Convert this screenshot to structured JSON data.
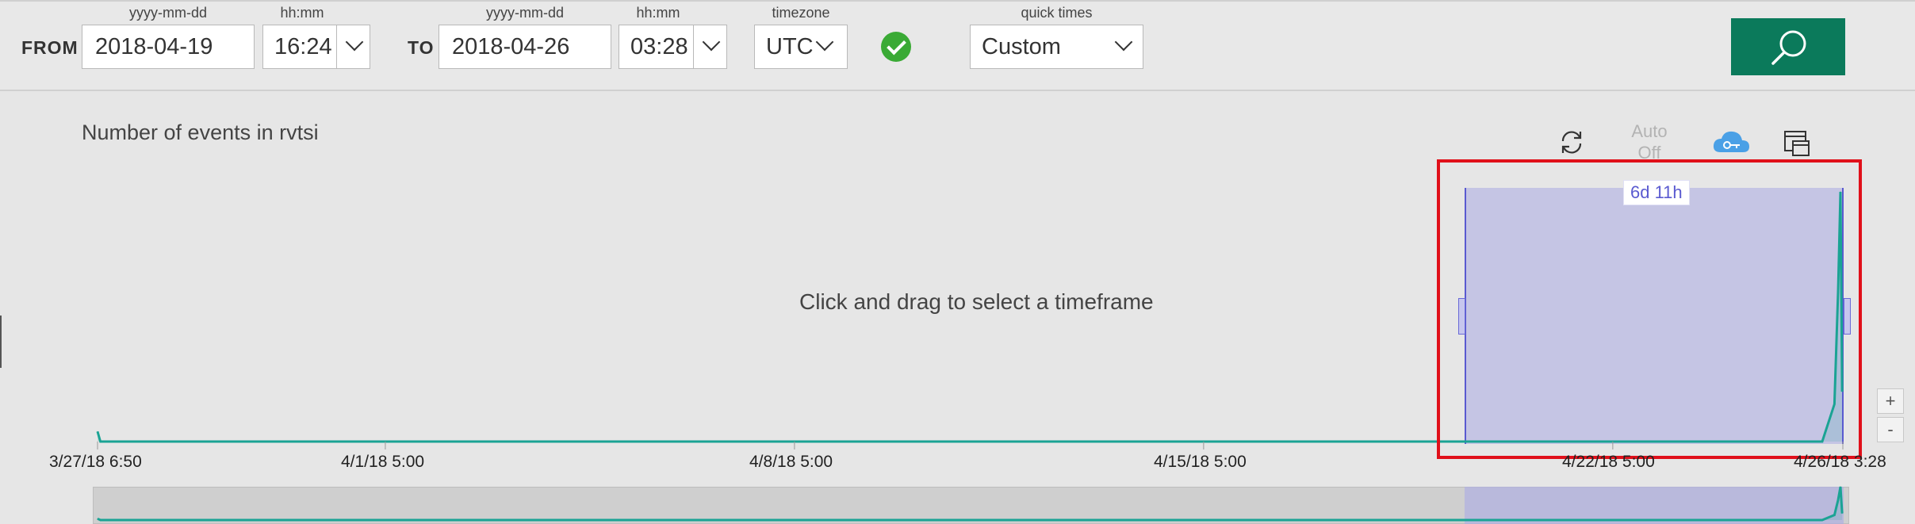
{
  "toolbar": {
    "from_label": "FROM",
    "to_label": "TO",
    "date_format_label": "yyyy-mm-dd",
    "time_format_label": "hh:mm",
    "timezone_label": "timezone",
    "quick_times_label": "quick times",
    "from_date": "2018-04-19",
    "from_time": "16:24",
    "to_date": "2018-04-26",
    "to_time": "03:28",
    "timezone": "UTC",
    "quick_time": "Custom",
    "status_icon": "check-circle-icon",
    "search_icon": "search-icon",
    "accent_color": "#0b7a5b"
  },
  "chart": {
    "title": "Number of events in rvtsi",
    "auto_refresh_label": "Auto",
    "auto_refresh_state": "Off",
    "refresh_icon": "refresh-icon",
    "cloud_icon": "cloud-key-icon",
    "copy_icon": "copy-window-icon",
    "hint": "Click and drag to select a timeframe",
    "selection_duration": "6d 11h",
    "zoom_in": "+",
    "zoom_out": "-",
    "series_color": "#1aa394",
    "selection_color": "#5a5ad0",
    "highlight_color": "#e0101a"
  },
  "chart_data": {
    "type": "area",
    "title": "Number of events in rvtsi",
    "x_tick_labels": [
      "3/27/18 6:50",
      "4/1/18 5:00",
      "4/8/18 5:00",
      "4/15/18 5:00",
      "4/22/18 5:00",
      "4/26/18 3:28"
    ],
    "xlim": [
      "2018-03-27T06:50",
      "2018-04-26T03:28"
    ],
    "selection": {
      "from": "2018-04-19T16:24",
      "to": "2018-04-26T03:28",
      "duration": "6d 11h"
    },
    "series": [
      {
        "values_normalized_peak": [
          {
            "t": "2018-03-27T06:50",
            "v": 0.04
          },
          {
            "t": "2018-03-27T08:00",
            "v": 0.0
          },
          {
            "t": "2018-04-25T19:00",
            "v": 0.0
          },
          {
            "t": "2018-04-26T00:00",
            "v": 0.15
          },
          {
            "t": "2018-04-26T01:30",
            "v": 0.6
          },
          {
            "t": "2018-04-26T02:30",
            "v": 1.0
          },
          {
            "t": "2018-04-26T03:10",
            "v": 0.2
          }
        ]
      }
    ],
    "grid": false
  }
}
